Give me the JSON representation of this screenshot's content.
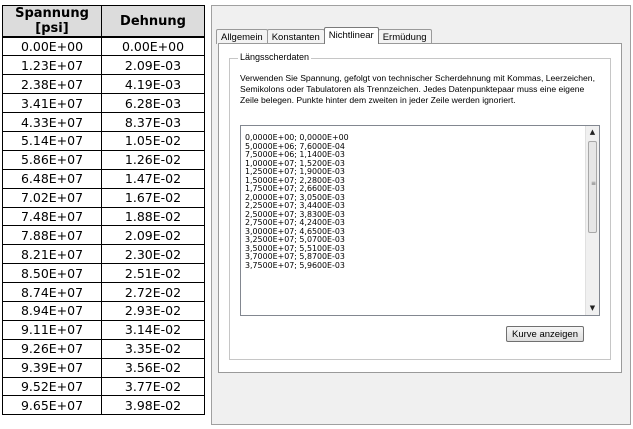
{
  "table": {
    "headers": [
      "Spannung [psi]",
      "Dehnung"
    ],
    "rows": [
      [
        "0.00E+00",
        "0.00E+00"
      ],
      [
        "1.23E+07",
        "2.09E-03"
      ],
      [
        "2.38E+07",
        "4.19E-03"
      ],
      [
        "3.41E+07",
        "6.28E-03"
      ],
      [
        "4.33E+07",
        "8.37E-03"
      ],
      [
        "5.14E+07",
        "1.05E-02"
      ],
      [
        "5.86E+07",
        "1.26E-02"
      ],
      [
        "6.48E+07",
        "1.47E-02"
      ],
      [
        "7.02E+07",
        "1.67E-02"
      ],
      [
        "7.48E+07",
        "1.88E-02"
      ],
      [
        "7.88E+07",
        "2.09E-02"
      ],
      [
        "8.21E+07",
        "2.30E-02"
      ],
      [
        "8.50E+07",
        "2.51E-02"
      ],
      [
        "8.74E+07",
        "2.72E-02"
      ],
      [
        "8.94E+07",
        "2.93E-02"
      ],
      [
        "9.11E+07",
        "3.14E-02"
      ],
      [
        "9.26E+07",
        "3.35E-02"
      ],
      [
        "9.39E+07",
        "3.56E-02"
      ],
      [
        "9.52E+07",
        "3.77E-02"
      ],
      [
        "9.65E+07",
        "3.98E-02"
      ]
    ]
  },
  "dialog": {
    "tabs": [
      {
        "label": "Allgemein",
        "active": false
      },
      {
        "label": "Konstanten",
        "active": false
      },
      {
        "label": "Nichtlinear",
        "active": true
      },
      {
        "label": "Ermüdung",
        "active": false
      }
    ],
    "group_title": "Längsscherdaten",
    "description": "Verwenden Sie Spannung, gefolgt von technischer Scherdehnung mit Kommas, Leerzeichen, Semikolons oder Tabulatoren als Trennzeichen. Jedes Datenpunktepaar muss eine eigene Zeile belegen. Punkte hinter dem zweiten in jeder Zeile werden ignoriert.",
    "data_lines": [
      "0,0000E+00; 0,0000E+00",
      "5,0000E+06; 7,6000E-04",
      "7,5000E+06; 1,1400E-03",
      "1,0000E+07; 1,5200E-03",
      "1,2500E+07; 1,9000E-03",
      "1,5000E+07; 2,2800E-03",
      "1,7500E+07; 2,6600E-03",
      "2,0000E+07; 3,0500E-03",
      "2,2500E+07; 3,4400E-03",
      "2,5000E+07; 3,8300E-03",
      "2,7500E+07; 4,2400E-03",
      "3,0000E+07; 4,6500E-03",
      "3,2500E+07; 5,0700E-03",
      "3,5000E+07; 5,5100E-03",
      "3,7000E+07; 5,8700E-03",
      "3,7500E+07; 5,9600E-03"
    ],
    "button_label": "Kurve anzeigen",
    "scroll_up_icon": "▲",
    "scroll_down_icon": "▼",
    "grip_icon": "≡"
  }
}
